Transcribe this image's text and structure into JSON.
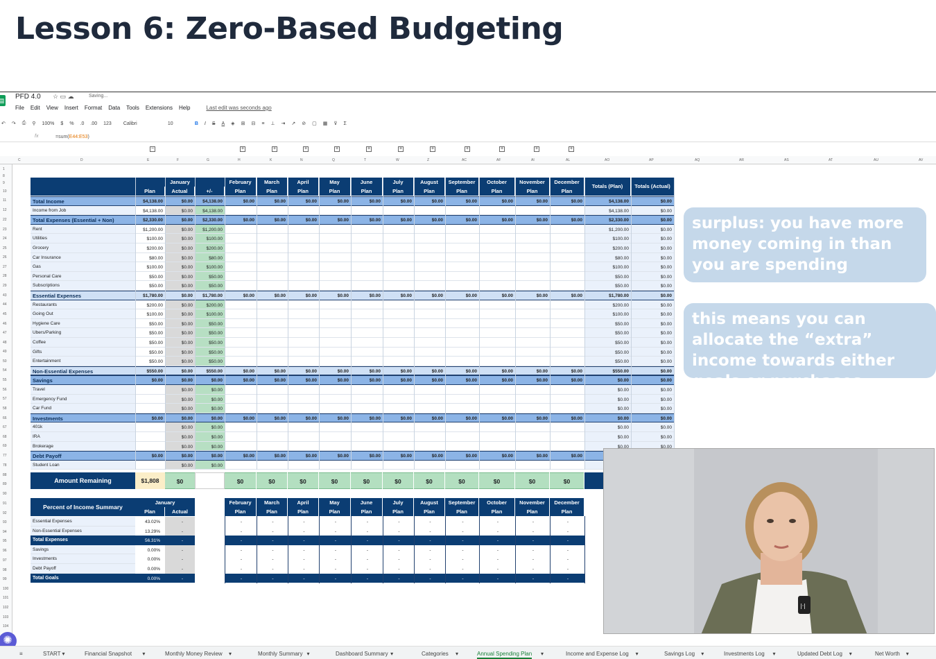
{
  "lesson_title": "Lesson 6: Zero-Based Budgeting",
  "doc": {
    "name": "PFD 4.0",
    "saving": "Saving...",
    "last_edit": "Last edit was seconds ago",
    "menu": [
      "File",
      "Edit",
      "View",
      "Insert",
      "Format",
      "Data",
      "Tools",
      "Extensions",
      "Help"
    ]
  },
  "toolbar": {
    "zoom": "100%",
    "currency": "$",
    "percent": "%",
    "dec1": ".0",
    "dec2": ".00",
    "numfmt": "123",
    "font": "Calibri",
    "size": "10",
    "bold": "B",
    "italic": "I",
    "strike": "S",
    "text_color": "A",
    "sum": "Σ"
  },
  "formula": {
    "fx": "fx",
    "prefix": "=sum(",
    "ref": "E44:E53",
    "suffix": ")"
  },
  "col_headers": [
    "C",
    "D",
    "E",
    "F",
    "G",
    "H",
    "K",
    "N",
    "Q",
    "T",
    "W",
    "Z",
    "AC",
    "AF",
    "AI",
    "AL",
    "AO",
    "AP",
    "AQ",
    "AR",
    "AS",
    "AT",
    "AU",
    "AV"
  ],
  "row_numbers": [
    "1",
    "8",
    "9",
    "10",
    "11",
    "12",
    "22",
    "23",
    "24",
    "25",
    "26",
    "27",
    "28",
    "29",
    "43",
    "44",
    "45",
    "46",
    "47",
    "48",
    "49",
    "50",
    "54",
    "55",
    "56",
    "57",
    "58",
    "66",
    "67",
    "68",
    "69",
    "77",
    "78",
    "88",
    "89",
    "90",
    "91",
    "92",
    "93",
    "94",
    "95",
    "96",
    "97",
    "98",
    "99",
    "100",
    "101",
    "102",
    "103",
    "104"
  ],
  "months": [
    "January",
    "February",
    "March",
    "April",
    "May",
    "June",
    "July",
    "August",
    "September",
    "October",
    "November",
    "December"
  ],
  "sub": {
    "plan": "Plan",
    "actual": "Actual",
    "diff": "+/-"
  },
  "totals_plan": "Totals (Plan)",
  "totals_actual": "Totals (Actual)",
  "rows": [
    {
      "label": "Total Income",
      "type": "total",
      "jp": "$4,138.00",
      "ja": "$0.00",
      "jd": "$4,138.00",
      "m": "$0.00",
      "tp": "$4,138.00",
      "ta": "$0.00"
    },
    {
      "label": "Income from Job",
      "type": "item",
      "jp": "$4,138.00",
      "ja": "$0.00",
      "jd": "$4,138.00",
      "tp": "$4,138.00",
      "ta": "$0.00"
    },
    {
      "label": "Total Expenses (Essential + Non)",
      "type": "total",
      "jp": "$2,330.00",
      "ja": "$0.00",
      "jd": "$2,330.00",
      "m": "$0.00",
      "tp": "$2,330.00",
      "ta": "$0.00"
    },
    {
      "label": "Rent",
      "type": "item",
      "jp": "$1,200.00",
      "ja": "$0.00",
      "jd": "$1,200.00",
      "tp": "$1,200.00",
      "ta": "$0.00"
    },
    {
      "label": "Utilities",
      "type": "item",
      "jp": "$100.00",
      "ja": "$0.00",
      "jd": "$100.00",
      "tp": "$100.00",
      "ta": "$0.00"
    },
    {
      "label": "Grocery",
      "type": "item",
      "jp": "$200.00",
      "ja": "$0.00",
      "jd": "$200.00",
      "tp": "$200.00",
      "ta": "$0.00"
    },
    {
      "label": "Car Insurance",
      "type": "item",
      "jp": "$80.00",
      "ja": "$0.00",
      "jd": "$80.00",
      "tp": "$80.00",
      "ta": "$0.00"
    },
    {
      "label": "Gas",
      "type": "item",
      "jp": "$100.00",
      "ja": "$0.00",
      "jd": "$100.00",
      "tp": "$100.00",
      "ta": "$0.00"
    },
    {
      "label": "Personal Care",
      "type": "item",
      "jp": "$50.00",
      "ja": "$0.00",
      "jd": "$50.00",
      "tp": "$50.00",
      "ta": "$0.00"
    },
    {
      "label": "Subscriptions",
      "type": "item",
      "jp": "$50.00",
      "ja": "$0.00",
      "jd": "$50.00",
      "tp": "$50.00",
      "ta": "$0.00"
    },
    {
      "label": "Essential Expenses",
      "type": "sub",
      "jp": "$1,780.00",
      "ja": "$0.00",
      "jd": "$1,780.00",
      "m": "$0.00",
      "tp": "$1,780.00",
      "ta": "$0.00"
    },
    {
      "label": "Restaurants",
      "type": "item",
      "jp": "$200.00",
      "ja": "$0.00",
      "jd": "$200.00",
      "tp": "$200.00",
      "ta": "$0.00"
    },
    {
      "label": "Going Out",
      "type": "item",
      "jp": "$100.00",
      "ja": "$0.00",
      "jd": "$100.00",
      "tp": "$100.00",
      "ta": "$0.00"
    },
    {
      "label": "Hygiene Care",
      "type": "item",
      "jp": "$50.00",
      "ja": "$0.00",
      "jd": "$50.00",
      "tp": "$50.00",
      "ta": "$0.00"
    },
    {
      "label": "Ubers/Parking",
      "type": "item",
      "jp": "$50.00",
      "ja": "$0.00",
      "jd": "$50.00",
      "tp": "$50.00",
      "ta": "$0.00"
    },
    {
      "label": "Coffee",
      "type": "item",
      "jp": "$50.00",
      "ja": "$0.00",
      "jd": "$50.00",
      "tp": "$50.00",
      "ta": "$0.00"
    },
    {
      "label": "Gifts",
      "type": "item",
      "jp": "$50.00",
      "ja": "$0.00",
      "jd": "$50.00",
      "tp": "$50.00",
      "ta": "$0.00"
    },
    {
      "label": "Entertainment",
      "type": "item",
      "jp": "$50.00",
      "ja": "$0.00",
      "jd": "$50.00",
      "tp": "$50.00",
      "ta": "$0.00"
    },
    {
      "label": "Non-Essential Expenses",
      "type": "sub",
      "jp": "$550.00",
      "ja": "$0.00",
      "jd": "$550.00",
      "m": "$0.00",
      "tp": "$550.00",
      "ta": "$0.00"
    },
    {
      "label": "Savings",
      "type": "total",
      "jp": "$0.00",
      "ja": "$0.00",
      "jd": "$0.00",
      "m": "$0.00",
      "tp": "$0.00",
      "ta": "$0.00"
    },
    {
      "label": "Travel",
      "type": "item",
      "jp": "",
      "ja": "$0.00",
      "jd": "$0.00",
      "tp": "$0.00",
      "ta": "$0.00"
    },
    {
      "label": "Emergency Fund",
      "type": "item",
      "jp": "",
      "ja": "$0.00",
      "jd": "$0.00",
      "tp": "$0.00",
      "ta": "$0.00"
    },
    {
      "label": "Car Fund",
      "type": "item",
      "jp": "",
      "ja": "$0.00",
      "jd": "$0.00",
      "tp": "$0.00",
      "ta": "$0.00"
    },
    {
      "label": "Investments",
      "type": "total",
      "jp": "$0.00",
      "ja": "$0.00",
      "jd": "$0.00",
      "m": "$0.00",
      "tp": "$0.00",
      "ta": "$0.00"
    },
    {
      "label": "401k",
      "type": "item",
      "jp": "",
      "ja": "$0.00",
      "jd": "$0.00",
      "tp": "$0.00",
      "ta": "$0.00"
    },
    {
      "label": "IRA",
      "type": "item",
      "jp": "",
      "ja": "$0.00",
      "jd": "$0.00",
      "tp": "$0.00",
      "ta": "$0.00"
    },
    {
      "label": "Brokerage",
      "type": "item",
      "jp": "",
      "ja": "$0.00",
      "jd": "$0.00",
      "tp": "$0.00",
      "ta": "$0.00"
    },
    {
      "label": "Debt Payoff",
      "type": "total",
      "jp": "$0.00",
      "ja": "$0.00",
      "jd": "$0.00",
      "m": "$0.00",
      "tp": "",
      "ta": ""
    },
    {
      "label": "Student Loan",
      "type": "item",
      "jp": "",
      "ja": "$0.00",
      "jd": "$0.00",
      "tp": "",
      "ta": ""
    }
  ],
  "remaining": {
    "label": "Amount Remaining",
    "jan_plan": "$1,808",
    "jan_actual": "$0",
    "months": "$0"
  },
  "summary": {
    "title": "Percent of Income Summary",
    "rows": [
      {
        "label": "Essential Expenses",
        "plan": "43.02%",
        "actual": "-",
        "type": "item"
      },
      {
        "label": "Non-Essential Expenses",
        "plan": "13.29%",
        "actual": "-",
        "type": "item"
      },
      {
        "label": "Total Expenses",
        "plan": "56.31%",
        "actual": "-",
        "type": "total"
      },
      {
        "label": "Savings",
        "plan": "0.00%",
        "actual": "-",
        "type": "item"
      },
      {
        "label": "Investments",
        "plan": "0.00%",
        "actual": "-",
        "type": "item"
      },
      {
        "label": "Debt Payoff",
        "plan": "0.00%",
        "actual": "-",
        "type": "item"
      },
      {
        "label": "Total Goals",
        "plan": "0.00%",
        "actual": "-",
        "type": "total"
      }
    ],
    "dash": "-"
  },
  "bubbles": [
    "surplus: you have more money coming in than you are spending",
    "this means you can allocate the “extra” income towards either goals or purchases"
  ],
  "webcam_label": "|·|",
  "tabs": [
    "START",
    "Financial Snapshot",
    "Monthly Money Review",
    "Monthly Summary",
    "Dashboard Summary",
    "Categories",
    "Annual Spending Plan",
    "Income and Expense Log",
    "Savings Log",
    "Investments Log",
    "Updated Debt Log",
    "Net Worth"
  ],
  "active_tab": "Annual Spending Plan",
  "colors": {
    "navy": "#0b3d73",
    "light_blue": "#8cb4e6",
    "green": "#b3dfc0",
    "jan_green": "#b7dfc3",
    "actual_grey": "#d9d9d9"
  }
}
